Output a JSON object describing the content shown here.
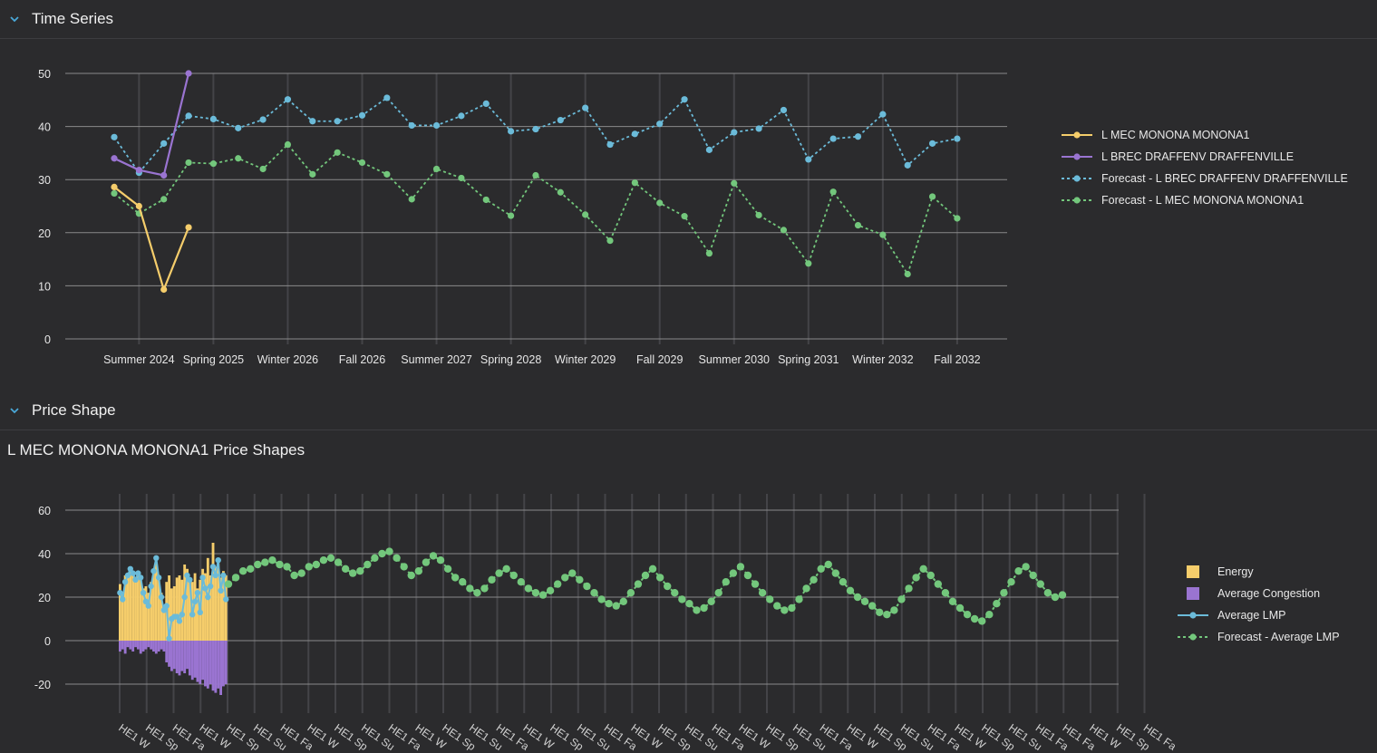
{
  "sections": {
    "time_series": {
      "title": "Time Series"
    },
    "price_shape": {
      "title": "Price Shape",
      "plot_title": "L MEC MONONA MONONA1 Price Shapes"
    }
  },
  "colors": {
    "energy": "#f5cd6b",
    "congestion": "#9a74d1",
    "lmp": "#6bbbd9",
    "forecast_green": "#73c77c",
    "grid": "#8a8a8a",
    "background": "#2b2b2d"
  },
  "chart_data": [
    {
      "type": "line",
      "title": "",
      "xlabel": "",
      "ylabel": "",
      "ylim": [
        0,
        50
      ],
      "y_ticks": [
        0,
        10,
        20,
        30,
        40,
        50
      ],
      "x_tick_labels": [
        "Summer 2024",
        "Spring 2025",
        "Winter 2026",
        "Fall 2026",
        "Summer 2027",
        "Spring 2028",
        "Winter 2029",
        "Fall 2029",
        "Summer 2030",
        "Spring 2031",
        "Winter 2032",
        "Fall 2032"
      ],
      "x_tick_index": [
        1,
        4,
        7,
        10,
        13,
        16,
        19,
        22,
        25,
        28,
        31,
        34
      ],
      "num_points": 35,
      "legend_position": "right",
      "series": [
        {
          "name": "L MEC MONONA MONONA1",
          "style": "solid",
          "color": "#f5cd6b",
          "values": [
            28.6,
            25.0,
            9.3,
            21.0
          ]
        },
        {
          "name": "L BREC DRAFFENV DRAFFENVILLE",
          "style": "solid",
          "color": "#9a74d1",
          "values": [
            34.0,
            31.8,
            30.8,
            50.0
          ]
        },
        {
          "name": "Forecast - L BREC DRAFFENV DRAFFENVILLE",
          "style": "dotted",
          "color": "#6bbbd9",
          "values": [
            38.0,
            31.3,
            36.8,
            42.0,
            41.4,
            39.7,
            41.3,
            45.1,
            41.0,
            41.0,
            42.1,
            45.4,
            40.2,
            40.2,
            42.0,
            44.3,
            39.1,
            39.5,
            41.2,
            43.5,
            36.6,
            38.6,
            40.5,
            45.1,
            35.6,
            38.9,
            39.6,
            43.1,
            33.8,
            37.7,
            38.1,
            42.3,
            32.7,
            36.8,
            37.7
          ]
        },
        {
          "name": "Forecast - L MEC MONONA MONONA1",
          "style": "dotted",
          "color": "#73c77c",
          "values": [
            27.4,
            23.6,
            26.3,
            33.2,
            33.0,
            34.0,
            32.0,
            36.6,
            31.0,
            35.1,
            33.2,
            31.0,
            26.3,
            32.0,
            30.3,
            26.2,
            23.2,
            30.8,
            27.6,
            23.4,
            18.5,
            29.4,
            25.6,
            23.1,
            16.1,
            29.3,
            23.3,
            20.5,
            14.2,
            27.7,
            21.4,
            19.6,
            12.2,
            26.8,
            22.7
          ]
        }
      ]
    },
    {
      "type": "bar",
      "title": "L MEC MONONA MONONA1 Price Shapes",
      "xlabel": "",
      "ylabel": "",
      "ylim": [
        -30,
        65
      ],
      "y_ticks": [
        -20,
        0,
        20,
        40,
        60
      ],
      "x_tick_labels": [
        "HE1 W",
        "HE1 Sp",
        "HE1 Fa",
        "HE1 W",
        "HE1 Sp",
        "HE1 Su",
        "HE1 Fa",
        "HE1 W",
        "HE1 Sp",
        "HE1 Su",
        "HE1 Fa",
        "HE1 W",
        "HE1 Sp",
        "HE1 Su",
        "HE1 Fa",
        "HE1 W",
        "HE1 Sp",
        "HE1 Su",
        "HE1 Fa",
        "HE1 W",
        "HE1 Sp",
        "HE1 Su",
        "HE1 Fa",
        "HE1 W",
        "HE1 Sp",
        "HE1 Su",
        "HE1 Fa",
        "HE1 W",
        "HE1 Sp",
        "HE1 Su",
        "HE1 Fa",
        "HE1 W",
        "HE1 Sp",
        "HE1 Su",
        "HE1 Fa",
        "HE1 Fa",
        "HE1 W",
        "HE1 Sp",
        "HE1 Fa"
      ],
      "legend_position": "right",
      "series": [
        {
          "name": "Energy",
          "kind": "bar",
          "color": "#f5cd6b",
          "values": [
            26,
            22,
            30,
            29,
            33,
            32,
            29,
            31,
            30,
            24,
            25,
            22,
            27,
            31,
            36,
            28,
            22,
            16,
            27,
            30,
            24,
            25,
            29,
            30,
            28,
            35,
            33,
            29,
            27,
            31,
            24,
            28,
            33,
            31,
            38,
            30,
            45,
            34,
            36,
            29,
            32,
            30
          ]
        },
        {
          "name": "Average Congestion",
          "kind": "bar",
          "color": "#9a74d1",
          "values": [
            -5,
            -4,
            -6,
            -3,
            -4,
            -5,
            -3,
            -4,
            -6,
            -5,
            -4,
            -3,
            -4,
            -5,
            -6,
            -5,
            -4,
            -5,
            -10,
            -12,
            -14,
            -13,
            -15,
            -16,
            -14,
            -15,
            -13,
            -16,
            -18,
            -17,
            -19,
            -20,
            -18,
            -21,
            -22,
            -20,
            -23,
            -24,
            -22,
            -25,
            -21,
            -20
          ]
        },
        {
          "name": "Average LMP",
          "kind": "line",
          "color": "#6bbbd9",
          "values": [
            22,
            19,
            27,
            30,
            33,
            31,
            28,
            31,
            29,
            22,
            18,
            16,
            25,
            32,
            38,
            29,
            20,
            14,
            16,
            1,
            10,
            11,
            11,
            9,
            12,
            20,
            30,
            28,
            12,
            18,
            22,
            13,
            29,
            24,
            20,
            25,
            34,
            30,
            37,
            23,
            30,
            19
          ]
        },
        {
          "name": "Forecast - Average LMP",
          "kind": "dotted",
          "color": "#73c77c",
          "values": [
            26,
            29,
            32,
            33,
            35,
            36,
            37,
            35,
            34,
            30,
            31,
            34,
            35,
            37,
            38,
            36,
            33,
            31,
            32,
            35,
            38,
            40,
            41,
            38,
            34,
            30,
            32,
            36,
            39,
            37,
            33,
            29,
            27,
            24,
            22,
            24,
            28,
            31,
            33,
            30,
            27,
            24,
            22,
            21,
            23,
            26,
            29,
            31,
            28,
            25,
            22,
            19,
            17,
            16,
            18,
            22,
            26,
            30,
            33,
            29,
            25,
            22,
            19,
            17,
            14,
            15,
            18,
            22,
            27,
            31,
            34,
            30,
            26,
            22,
            19,
            16,
            14,
            15,
            19,
            24,
            28,
            33,
            35,
            31,
            27,
            23,
            20,
            18,
            16,
            13,
            12,
            14,
            19,
            24,
            29,
            33,
            30,
            26,
            22,
            18,
            15,
            12,
            10,
            9,
            12,
            17,
            22,
            27,
            32,
            34,
            30,
            26,
            22,
            20,
            21
          ]
        }
      ]
    }
  ]
}
